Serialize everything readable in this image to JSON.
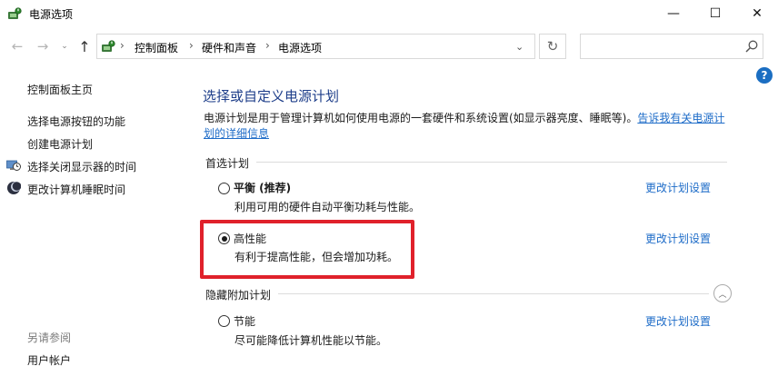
{
  "window": {
    "title": "电源选项",
    "controls": {
      "minimize": "—",
      "maximize": "☐",
      "close": "✕"
    }
  },
  "navigation": {
    "back": "←",
    "forward": "→",
    "recent": "⌄",
    "up": "↑",
    "breadcrumbs": [
      "控制面板",
      "硬件和声音",
      "电源选项"
    ],
    "separator": "›",
    "address_dropdown": "⌄",
    "refresh": "↻",
    "search_placeholder": ""
  },
  "help_label": "?",
  "sidebar": {
    "home": "控制面板主页",
    "items": [
      {
        "label": "选择电源按钮的功能",
        "icon": ""
      },
      {
        "label": "创建电源计划",
        "icon": ""
      },
      {
        "label": "选择关闭显示器的时间",
        "icon": "display-clock-icon"
      },
      {
        "label": "更改计算机睡眠时间",
        "icon": "moon-icon"
      }
    ],
    "see_also": "另请参阅",
    "see_also_items": [
      "用户帐户"
    ]
  },
  "main": {
    "title": "选择或自定义电源计划",
    "description": "电源计划是用于管理计算机如何使用电源的一套硬件和系统设置(如显示器亮度、睡眠等)。",
    "description_link": "告诉我有关电源计划的详细信息",
    "preferred_label": "首选计划",
    "hidden_label": "隐藏附加计划",
    "collapse_glyph": "︿",
    "plans": [
      {
        "name": "平衡 (推荐)",
        "description": "利用可用的硬件自动平衡功耗与性能。",
        "selected": false,
        "link": "更改计划设置"
      },
      {
        "name": "高性能",
        "description": "有利于提高性能，但会增加功耗。",
        "selected": true,
        "link": "更改计划设置"
      },
      {
        "name": "节能",
        "description": "尽可能降低计算机性能以节能。",
        "selected": false,
        "link": "更改计划设置"
      }
    ]
  },
  "colors": {
    "title_blue": "#1e3e8a",
    "link_blue": "#1e6cc8",
    "highlight_red": "#e0212b",
    "help_blue": "#1b6ec2"
  }
}
